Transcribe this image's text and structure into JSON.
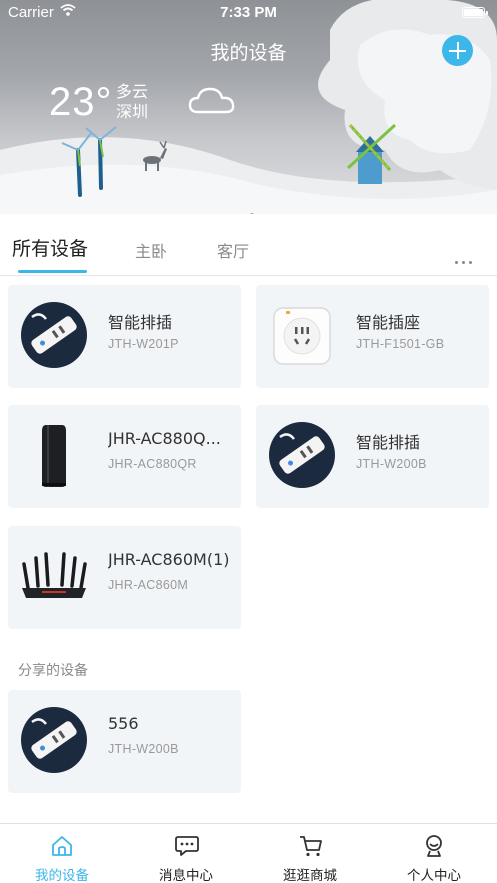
{
  "status_bar": {
    "carrier": "Carrier",
    "time": "7:33 PM"
  },
  "header": {
    "title": "我的设备",
    "temperature": "23°",
    "condition": "多云",
    "city": "深圳",
    "weather_icon": "cloud-icon",
    "add_icon": "plus-icon",
    "page_dots": {
      "count": 2,
      "active_index": 0
    }
  },
  "tabs": [
    {
      "label": "所有设备",
      "active": true
    },
    {
      "label": "主卧",
      "active": false
    },
    {
      "label": "客厅",
      "active": false
    }
  ],
  "more_icon": "more-dots-icon",
  "devices": [
    {
      "name": "智能排插",
      "model": "JTH-W201P",
      "image": "power-strip"
    },
    {
      "name": "智能插座",
      "model": "JTH-F1501-GB",
      "image": "smart-socket"
    },
    {
      "name": "JHR-AC880Q...",
      "model": "JHR-AC880QR",
      "image": "tower-router"
    },
    {
      "name": "智能排插",
      "model": "JTH-W200B",
      "image": "power-strip"
    },
    {
      "name": "JHR-AC860M(1)",
      "model": "JHR-AC860M",
      "image": "antenna-router"
    }
  ],
  "shared_section": {
    "label": "分享的设备",
    "devices": [
      {
        "name": "556",
        "model": "JTH-W200B",
        "image": "power-strip"
      }
    ]
  },
  "bottom_nav": [
    {
      "label": "我的设备",
      "icon": "home-icon",
      "active": true
    },
    {
      "label": "消息中心",
      "icon": "message-icon",
      "active": false
    },
    {
      "label": "逛逛商城",
      "icon": "cart-icon",
      "active": false
    },
    {
      "label": "个人中心",
      "icon": "user-icon",
      "active": false
    }
  ],
  "colors": {
    "accent": "#3cb7ea",
    "card_bg": "#f2f5f8",
    "text": "#333333",
    "muted": "#999999"
  }
}
